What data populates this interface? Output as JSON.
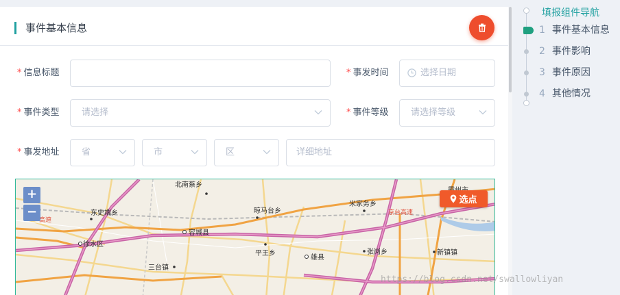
{
  "header": {
    "title": "事件基本信息"
  },
  "form": {
    "title_label": "信息标题",
    "title_value": "",
    "time_label": "事发时间",
    "time_placeholder": "选择日期",
    "type_label": "事件类型",
    "type_placeholder": "请选择",
    "level_label": "事件等级",
    "level_placeholder": "请选择等级",
    "address_label": "事发地址",
    "province_placeholder": "省",
    "city_placeholder": "市",
    "district_placeholder": "区",
    "detail_placeholder": "详细地址",
    "required_mark": "*"
  },
  "map": {
    "zoom_in": "+",
    "zoom_out": "−",
    "select_point": "选点",
    "places": [
      "北南蔡乡",
      "东史端乡",
      "晾马台乡",
      "米家务乡",
      "霸州市",
      "容城县",
      "徐水区",
      "平王乡",
      "雄县",
      "张岗乡",
      "新镇镇",
      "三台镇"
    ],
    "roads": [
      "高速",
      "京台高速"
    ]
  },
  "nav": {
    "title": "填报组件导航",
    "items": [
      {
        "num": "1",
        "label": "事件基本信息"
      },
      {
        "num": "2",
        "label": "事件影响"
      },
      {
        "num": "3",
        "label": "事件原因"
      },
      {
        "num": "4",
        "label": "其他情况"
      }
    ]
  },
  "watermark": "https://blog.csdn.net/swallowliyan",
  "colors": {
    "accent": "#20a0a0",
    "danger": "#ee4d2d",
    "map_border": "#32b99a",
    "select_point": "#f05a2a"
  }
}
